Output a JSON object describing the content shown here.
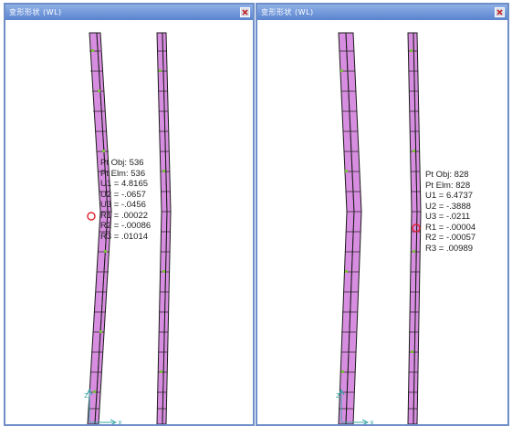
{
  "windows": [
    {
      "title": "变形形状 (WL)",
      "close_icon": "close-icon",
      "point_info": {
        "pt_obj": "Pt Obj: 536",
        "pt_elm": "Pt Elm: 536",
        "u1": "U1 =  4.8165",
        "u2": "U2 = -.0657",
        "u3": "U3 = -.0456",
        "r1": "R1 =  .00022",
        "r2": "R2 = -.00086",
        "r3": "R3 =  .01014"
      },
      "axis": {
        "z_label": "Z",
        "x_label": "X"
      }
    },
    {
      "title": "变形形状 (WL)",
      "close_icon": "close-icon",
      "point_info": {
        "pt_obj": "Pt Obj: 828",
        "pt_elm": "Pt Elm: 828",
        "u1": "U1 =  6.4737",
        "u2": "U2 = -.3888",
        "u3": "U3 = -.0211",
        "r1": "R1 = -.00004",
        "r2": "R2 = -.00057",
        "r3": "R3 =  .00989"
      },
      "axis": {
        "z_label": "Z",
        "x_label": "X"
      }
    }
  ],
  "colors": {
    "frame_border": "#6e8fc7",
    "titlebar": "#5a84cf",
    "mesh_fill": "#d88ee0",
    "mesh_line": "#1a1a1a",
    "node_marker": "#7fbf3f",
    "selected_point": "#e0202a",
    "axis": "#3aa6a6"
  }
}
